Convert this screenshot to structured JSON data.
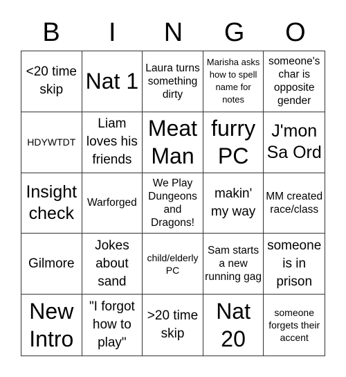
{
  "title_letters": [
    "B",
    "I",
    "N",
    "G",
    "O"
  ],
  "cells": [
    {
      "text": "<20 time skip",
      "size": "s-m"
    },
    {
      "text": "Nat 1",
      "size": "s-xl"
    },
    {
      "text": "Laura turns something dirty",
      "size": "s-sm"
    },
    {
      "text": "Marisha asks how to spell name for notes",
      "size": "s-xs"
    },
    {
      "text": "someone's char is opposite gender",
      "size": "s-sm"
    },
    {
      "text": "HDYWTDT",
      "size": "s-s"
    },
    {
      "text": "Liam loves his friends",
      "size": "s-m"
    },
    {
      "text": "Meat Man",
      "size": "s-xl"
    },
    {
      "text": "furry PC",
      "size": "s-xl"
    },
    {
      "text": "J'mon Sa Ord",
      "size": "s-l"
    },
    {
      "text": "Insight check",
      "size": "s-l"
    },
    {
      "text": "Warforged",
      "size": "s-sm"
    },
    {
      "text": "We Play Dungeons and Dragons!",
      "size": "s-sm"
    },
    {
      "text": "makin' my way",
      "size": "s-m"
    },
    {
      "text": "MM created race/class",
      "size": "s-sm"
    },
    {
      "text": "Gilmore",
      "size": "s-m"
    },
    {
      "text": "Jokes about sand",
      "size": "s-m"
    },
    {
      "text": "child/elderly PC",
      "size": "s-s"
    },
    {
      "text": "Sam starts a new running gag",
      "size": "s-sm"
    },
    {
      "text": "someone is in prison",
      "size": "s-m"
    },
    {
      "text": "New Intro",
      "size": "s-xl"
    },
    {
      "text": "\"I forgot how to play\"",
      "size": "s-m"
    },
    {
      "text": ">20 time skip",
      "size": "s-m"
    },
    {
      "text": "Nat 20",
      "size": "s-xl"
    },
    {
      "text": "someone forgets their accent",
      "size": "s-s"
    }
  ]
}
